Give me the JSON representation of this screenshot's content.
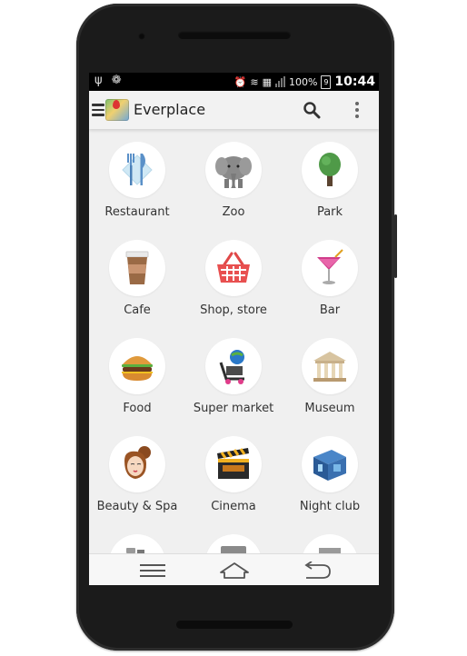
{
  "status_bar": {
    "battery": "100%",
    "battery_level_digit": "9",
    "time": "10:44"
  },
  "app_bar": {
    "title": "Everplace"
  },
  "categories": [
    {
      "label": "Restaurant",
      "icon": "fork-knife-icon"
    },
    {
      "label": "Zoo",
      "icon": "elephant-icon"
    },
    {
      "label": "Park",
      "icon": "tree-icon"
    },
    {
      "label": "Cafe",
      "icon": "coffee-cup-icon"
    },
    {
      "label": "Shop, store",
      "icon": "shopping-basket-icon"
    },
    {
      "label": "Bar",
      "icon": "cocktail-icon"
    },
    {
      "label": "Food",
      "icon": "burger-icon"
    },
    {
      "label": "Super market",
      "icon": "shopping-cart-icon"
    },
    {
      "label": "Museum",
      "icon": "museum-icon"
    },
    {
      "label": "Beauty & Spa",
      "icon": "spa-woman-icon"
    },
    {
      "label": "Cinema",
      "icon": "clapperboard-icon"
    },
    {
      "label": "Night club",
      "icon": "night-club-icon"
    }
  ],
  "colors": {
    "screen_bg": "#f0f0f0",
    "status_bar": "#000000",
    "phone_body": "#1b1b1b"
  }
}
